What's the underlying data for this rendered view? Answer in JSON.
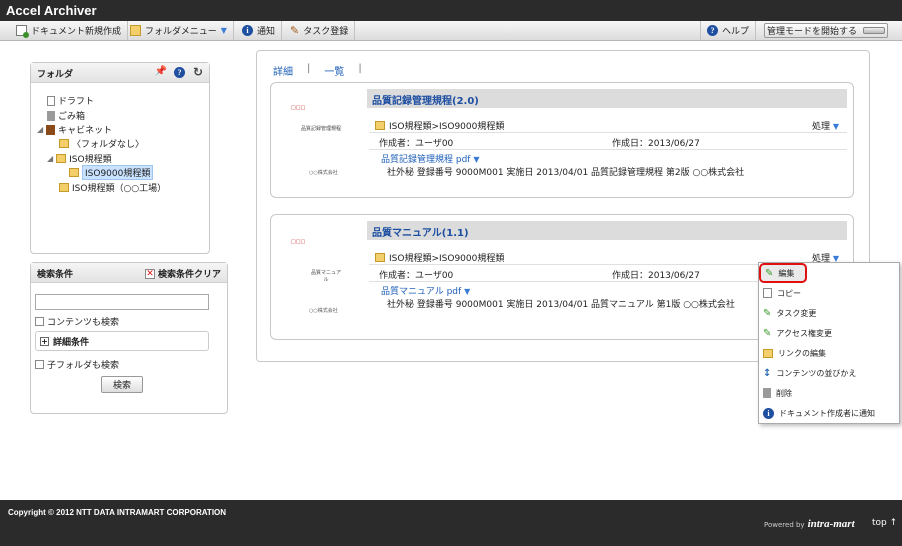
{
  "app": {
    "title": "Accel Archiver"
  },
  "toolbar": {
    "new_doc": "ドキュメント新規作成",
    "folder_menu": "フォルダメニュー",
    "notify": "通知",
    "task_register": "タスク登録",
    "help": "ヘルプ",
    "admin_mode": "管理モードを開始する"
  },
  "tabs": {
    "detail": "詳細",
    "list": "一覧",
    "sep": "|"
  },
  "folder_panel": {
    "title": "フォルダ",
    "items": [
      {
        "label": "ドラフト"
      },
      {
        "label": "ごみ箱"
      },
      {
        "label": "キャビネット"
      },
      {
        "label": "〈フォルダなし〉"
      },
      {
        "label": "ISO規程類"
      },
      {
        "label": "ISO9000規程類"
      },
      {
        "label": "ISO規程類（○○工場）"
      }
    ]
  },
  "search_panel": {
    "title": "検索条件",
    "clear": "検索条件クリア",
    "input_value": "",
    "content_search": "コンテンツも検索",
    "detail_conditions": "詳細条件",
    "subfolder_search": "子フォルダも検索",
    "search_button": "検索"
  },
  "documents": [
    {
      "title": "品質記録管理規程(2.0)",
      "path": "ISO規程類>ISO9000規程類",
      "action": "処理",
      "creator": "作成者：ユーザ00",
      "created": "作成日：2013/06/27",
      "file": "品質記録管理規程 pdf",
      "desc": "社外秘  登録番号 9000M001  実施日 2013/04/01 品質記録管理規程 第2版 ○○株式会社",
      "thumb_title": "品質記録管理規程",
      "thumb_company": "○○株式会社"
    },
    {
      "title": "品質マニュアル(1.1)",
      "path": "ISO規程類>ISO9000規程類",
      "action": "処理",
      "creator": "作成者：ユーザ00",
      "created": "作成日：2013/06/27",
      "file": "品質マニュアル pdf",
      "desc": "社外秘  登録番号 9000M001  実施日 2013/04/01 品質マニュアル 第1版 ○○株式会社",
      "thumb_title": "品質マニュアル",
      "thumb_company": "○○株式会社"
    }
  ],
  "context_menu": {
    "items": [
      "編集",
      "コピー",
      "タスク変更",
      "アクセス権変更",
      "リンクの編集",
      "コンテンツの並びかえ",
      "削除",
      "ドキュメント作成者に通知"
    ],
    "highlight_color": "#e01010"
  },
  "footer": {
    "copyright": "Copyright © 2012 NTT DATA INTRAMART CORPORATION",
    "powered_by": "Powered by",
    "brand": "intra-mart",
    "top": "top ↑"
  }
}
